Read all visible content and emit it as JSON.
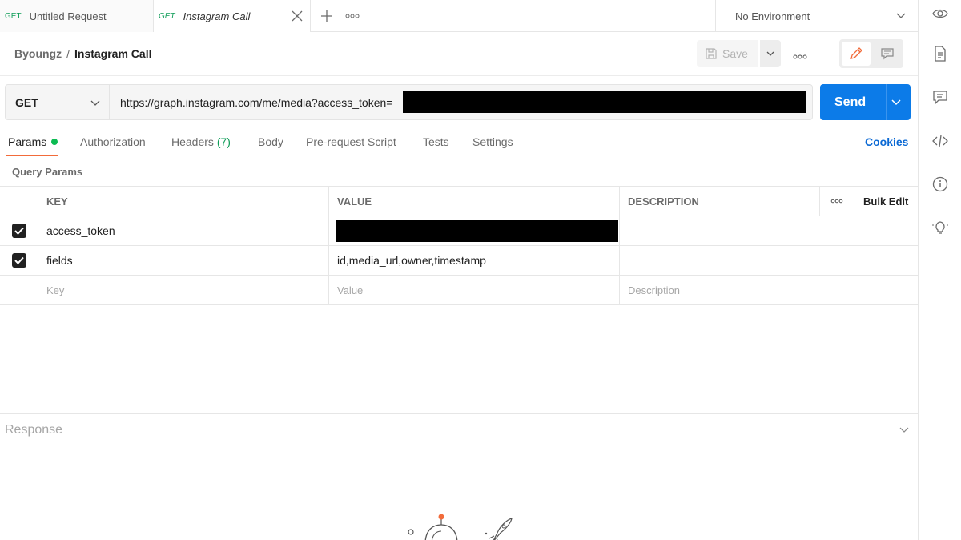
{
  "tabs": [
    {
      "method": "GET",
      "name": "Untitled Request"
    },
    {
      "method": "GET",
      "name": "Instagram Call"
    }
  ],
  "environment": {
    "selected": "No Environment"
  },
  "breadcrumb": {
    "workspace": "Byoungz",
    "separator": "/",
    "request": "Instagram Call"
  },
  "toolbar": {
    "save_label": "Save"
  },
  "request": {
    "method": "GET",
    "url": "https://graph.instagram.com/me/media?access_token=",
    "send_label": "Send"
  },
  "request_tabs": {
    "params": "Params",
    "authorization": "Authorization",
    "headers": "Headers",
    "headers_count": "(7)",
    "body": "Body",
    "pre_request": "Pre-request Script",
    "tests": "Tests",
    "settings": "Settings",
    "cookies": "Cookies"
  },
  "query_params": {
    "title": "Query Params",
    "columns": {
      "key": "KEY",
      "value": "VALUE",
      "description": "DESCRIPTION",
      "bulk_edit": "Bulk Edit"
    },
    "rows": [
      {
        "key": "access_token",
        "value": "",
        "checked": true
      },
      {
        "key": "fields",
        "value": "id,media_url,owner,timestamp",
        "checked": true
      }
    ],
    "placeholders": {
      "key": "Key",
      "value": "Value",
      "description": "Description"
    }
  },
  "response": {
    "title": "Response"
  },
  "colors": {
    "accent": "#0c7be8",
    "active_tab_underline": "#f26b3a",
    "get_method": "#0f9d58",
    "params_dot": "#0cbb52"
  }
}
